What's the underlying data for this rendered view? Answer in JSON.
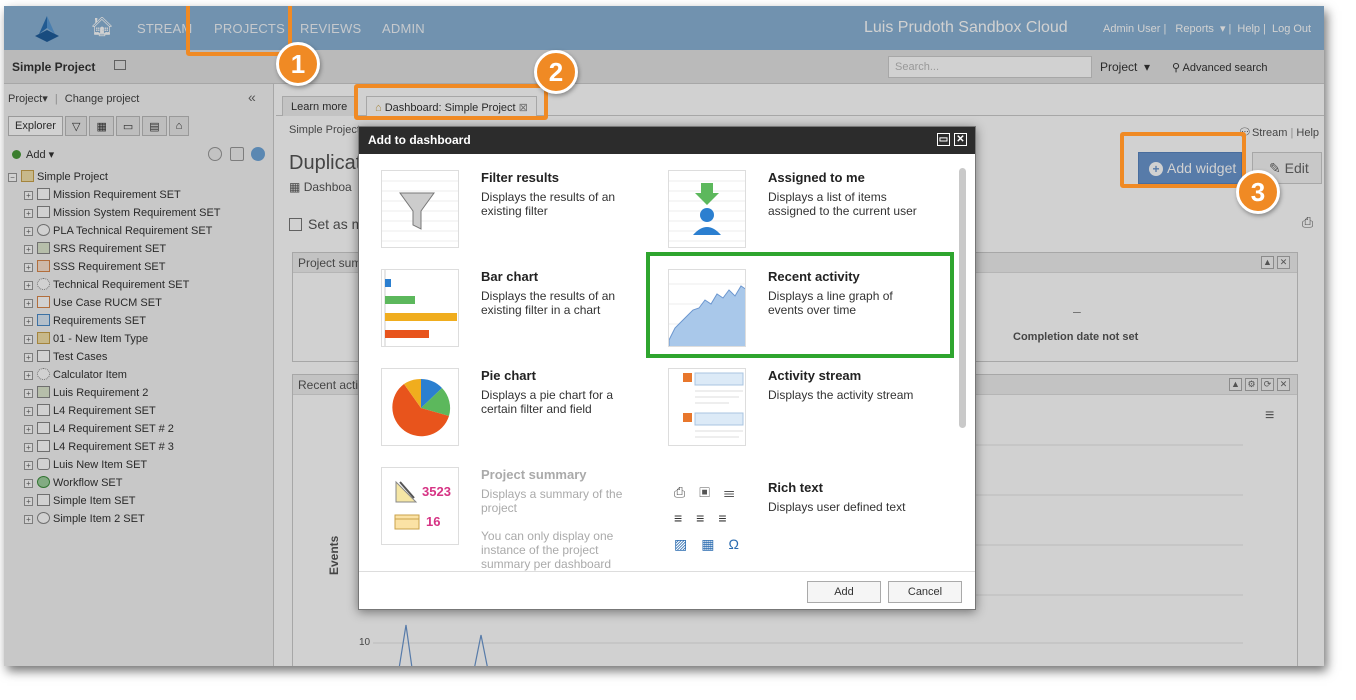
{
  "topbar": {
    "nav": [
      "STREAM",
      "PROJECTS",
      "REVIEWS",
      "ADMIN"
    ],
    "site_title": "Luis Prudoth Sandbox Cloud",
    "user": "Admin User",
    "reports": "Reports",
    "help": "Help",
    "logout": "Log Out"
  },
  "subbar": {
    "project_name": "Simple Project",
    "search_placeholder": "Search...",
    "scope": "Project",
    "advanced": "Advanced search"
  },
  "sidebar": {
    "project_menu": "Project▾",
    "change_project": "Change project",
    "explorer_tab": "Explorer",
    "add": "Add",
    "tree": [
      "Simple Project",
      "Mission Requirement SET",
      "Mission System Requirement SET",
      "PLA Technical Requirement SET",
      "SRS Requirement SET",
      "SSS Requirement SET",
      "Technical Requirement SET",
      "Use Case RUCM SET",
      "Requirements SET",
      "01 - New Item Type",
      "Test Cases",
      "Calculator Item",
      "Luis Requirement 2",
      "L4 Requirement SET",
      "L4 Requirement SET # 2",
      "L4 Requirement SET # 3",
      "Luis New Item SET",
      "Workflow SET",
      "Simple Item SET",
      "Simple Item 2 SET"
    ]
  },
  "main": {
    "tabs": [
      "Learn more",
      "Dashboard: Simple Project"
    ],
    "breadcrumb": "Simple Project",
    "page_title": "Duplicate",
    "dashboard_label": "Dashboa",
    "set_as": "Set as m",
    "stream_link": "Stream",
    "help_link": "Help",
    "add_widget": "Add widget",
    "edit": "Edit",
    "panel1_title": "Project sum",
    "panel1_dash": "–",
    "completion": "Completion date not set",
    "panel2_title": "Recent activ",
    "axis_label": "Events",
    "axis_tick": "10"
  },
  "dialog": {
    "title": "Add to dashboard",
    "widgets": [
      {
        "title": "Filter results",
        "desc": "Displays the results of an existing filter"
      },
      {
        "title": "Assigned to me",
        "desc": "Displays a list of items assigned to the current user"
      },
      {
        "title": "Bar chart",
        "desc": "Displays the results of an existing filter in a chart"
      },
      {
        "title": "Recent activity",
        "desc": "Displays a line graph of events over time"
      },
      {
        "title": "Pie chart",
        "desc": "Displays a pie chart for a certain filter and field"
      },
      {
        "title": "Activity stream",
        "desc": "Displays the activity stream"
      },
      {
        "title": "Project summary",
        "desc": "Displays a summary of the project",
        "note": "You can only display one instance of the project summary per dashboard",
        "stat1": "3523",
        "stat2": "16"
      },
      {
        "title": "Rich text",
        "desc": "Displays user defined text"
      }
    ],
    "add_button": "Add",
    "cancel_button": "Cancel"
  },
  "annotations": [
    "1",
    "2",
    "3"
  ],
  "colors": {
    "highlight_orange": "#f08a24",
    "highlight_green": "#2ea52e",
    "topbar": "#8ab3d6",
    "primary_button": "#6b96cf"
  }
}
